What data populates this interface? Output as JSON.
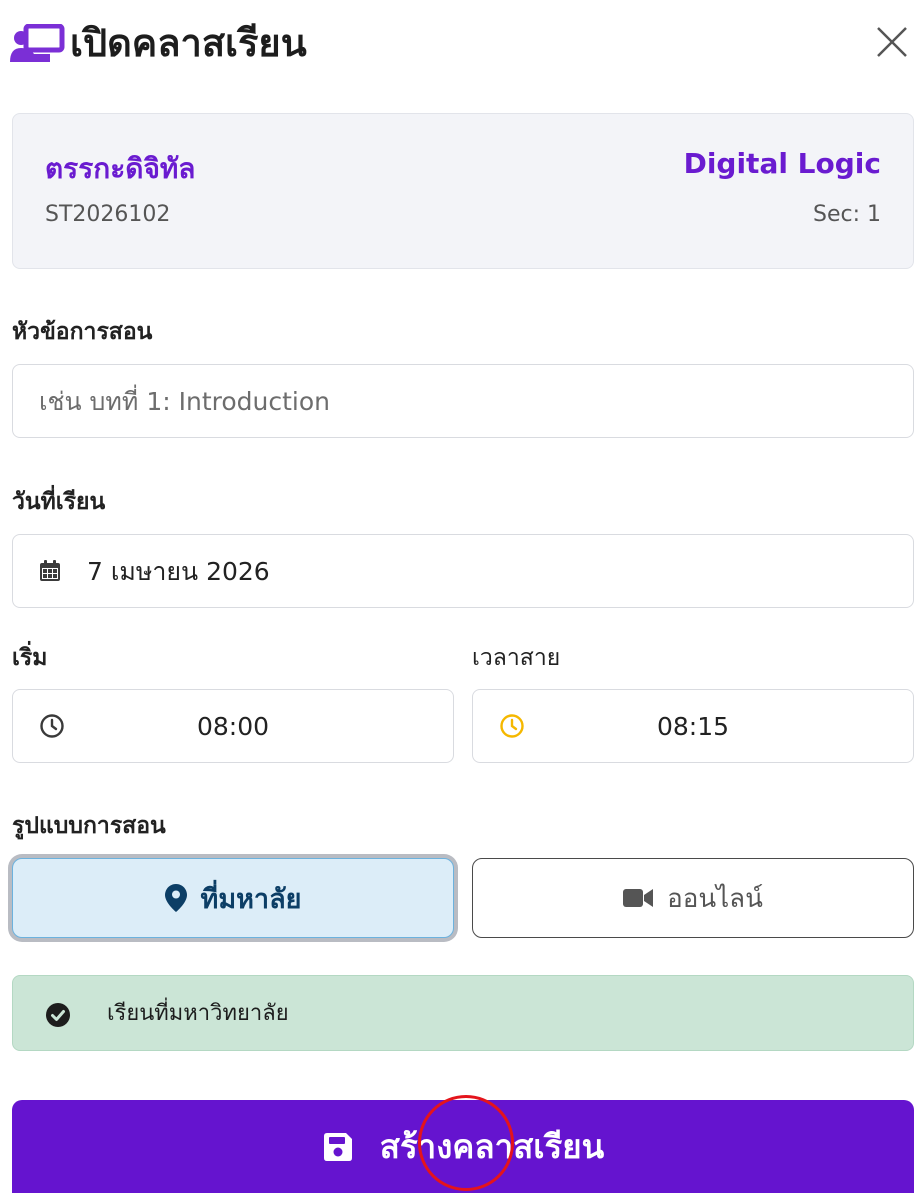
{
  "dialog": {
    "title": "เปิดคลาสเรียน",
    "close_icon": "close-icon",
    "header_icon": "chalkboard-teacher-icon"
  },
  "course": {
    "name_th": "ตรรกะดิจิทัล",
    "name_en": "Digital Logic",
    "code": "ST2026102",
    "section": "Sec: 1"
  },
  "topic": {
    "label": "หัวข้อการสอน",
    "value": "",
    "placeholder": "เช่น บทที่ 1: Introduction"
  },
  "date": {
    "label": "วันที่เรียน",
    "value": "7 เมษายน 2026",
    "icon": "calendar-icon"
  },
  "start_time": {
    "label": "เริ่ม",
    "value": "08:00",
    "icon": "clock-icon"
  },
  "late_time": {
    "label": "เวลาสาย",
    "value": "08:15",
    "icon": "clock-icon",
    "icon_color": "#f5b800"
  },
  "mode": {
    "label": "รูปแบบการสอน",
    "options": [
      {
        "label": "ที่มหาลัย",
        "icon": "map-pin-icon",
        "selected": true
      },
      {
        "label": "ออนไลน์",
        "icon": "video-camera-icon",
        "selected": false
      }
    ]
  },
  "alert": {
    "text": "เรียนที่มหาวิทยาลัย",
    "icon": "check-circle-icon"
  },
  "submit": {
    "label": "สร้างคลาสเรียน",
    "icon": "save-icon"
  },
  "colors": {
    "accent": "#6514cf",
    "course_title": "#6a1bd0",
    "onsite_bg": "#dcedf8",
    "alert_bg": "#cbe5d6"
  }
}
